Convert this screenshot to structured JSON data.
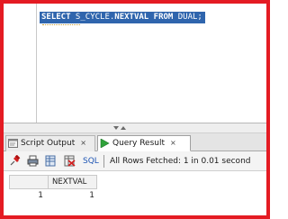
{
  "editor": {
    "keyword_select": "SELECT",
    "sequence": " S_CYCLE.",
    "keyword_nextval": "NEXTVAL",
    "keyword_from": " FROM ",
    "table": "DUAL;"
  },
  "tabs": [
    {
      "label": "Script Output",
      "close": "×",
      "icon": "script-output-icon"
    },
    {
      "label": "Query Result",
      "close": "×",
      "icon": "query-result-play-icon"
    }
  ],
  "toolbar": {
    "sql_label": "SQL",
    "status": "All Rows Fetched: 1 in 0.01 second"
  },
  "grid": {
    "columns": [
      "NEXTVAL"
    ],
    "rows": [
      {
        "row_number": "1",
        "values": [
          "1"
        ]
      }
    ]
  },
  "colors": {
    "frame": "#e41b23",
    "selection": "#2f65ad",
    "sql_link": "#1f56b4"
  }
}
